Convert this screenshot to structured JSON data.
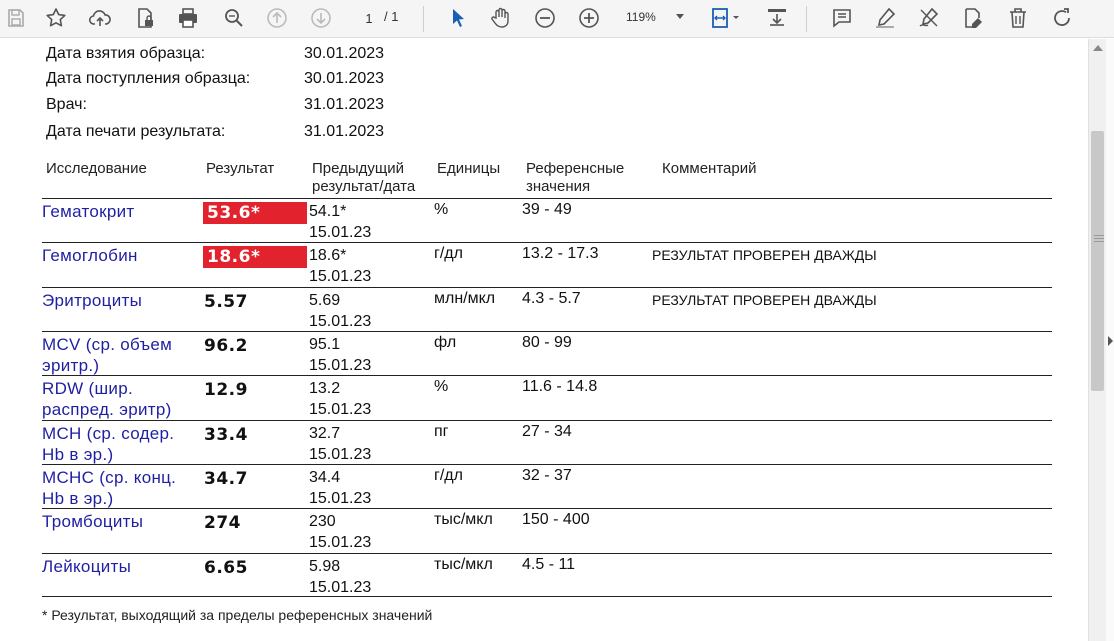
{
  "toolbar": {
    "page_current": "1",
    "page_total": "/ 1",
    "zoom": "119%",
    "icons": [
      "save-icon",
      "bookmark-star-icon",
      "upload-icon",
      "file-lock-icon",
      "print-icon",
      "zoom-search-icon",
      "arrow-up-icon",
      "arrow-down-icon",
      "select-cursor-icon",
      "hand-tool-icon",
      "zoom-out-icon",
      "zoom-in-icon",
      "fit-page-icon",
      "download-tray-icon",
      "comment-icon",
      "highlight-pen-icon",
      "sign-pen-icon",
      "edit-document-icon",
      "trash-icon",
      "rotate-icon"
    ]
  },
  "info": [
    {
      "label": "Дата взятия образца:",
      "value": "30.01.2023"
    },
    {
      "label": "Дата поступления образца:",
      "value": "30.01.2023"
    },
    {
      "label": "Врач:",
      "value": "31.01.2023"
    },
    {
      "label": "Дата печати результата:",
      "value": "31.01.2023"
    }
  ],
  "table": {
    "headers": {
      "test": "Исследование",
      "result": "Результат",
      "prev1": "Предыдущий",
      "prev2": "результат/дата",
      "units": "Единицы",
      "ref1": "Референсные",
      "ref2": "значения",
      "comment": "Комментарий"
    },
    "rows": [
      {
        "name1": "Гематокрит",
        "name2": "",
        "result": "53.6*",
        "flag": true,
        "prev": "54.1*",
        "prev_date": "15.01.23",
        "unit": "%",
        "ref": "39 - 49",
        "comment": ""
      },
      {
        "name1": "Гемоглобин",
        "name2": "",
        "result": "18.6*",
        "flag": true,
        "prev": "18.6*",
        "prev_date": "15.01.23",
        "unit": "г/дл",
        "ref": "13.2 - 17.3",
        "comment": "РЕЗУЛЬТАТ ПРОВЕРЕН ДВАЖДЫ"
      },
      {
        "name1": "Эритроциты",
        "name2": "",
        "result": "5.57",
        "flag": false,
        "prev": "5.69",
        "prev_date": "15.01.23",
        "unit": "млн/мкл",
        "ref": "4.3 - 5.7",
        "comment": "РЕЗУЛЬТАТ ПРОВЕРЕН ДВАЖДЫ"
      },
      {
        "name1": "MCV (ср. объем",
        "name2": "эритр.)",
        "result": "96.2",
        "flag": false,
        "prev": "95.1",
        "prev_date": "15.01.23",
        "unit": "фл",
        "ref": "80 - 99",
        "comment": ""
      },
      {
        "name1": "RDW (шир.",
        "name2": "распред. эритр)",
        "result": "12.9",
        "flag": false,
        "prev": "13.2",
        "prev_date": "15.01.23",
        "unit": "%",
        "ref": "11.6 - 14.8",
        "comment": ""
      },
      {
        "name1": "MCH (ср. содер.",
        "name2": "Hb в эр.)",
        "result": "33.4",
        "flag": false,
        "prev": "32.7",
        "prev_date": "15.01.23",
        "unit": "пг",
        "ref": "27 - 34",
        "comment": ""
      },
      {
        "name1": "MCHC (ср. конц.",
        "name2": "Hb в эр.)",
        "result": "34.7",
        "flag": false,
        "prev": "34.4",
        "prev_date": "15.01.23",
        "unit": "г/дл",
        "ref": "32 - 37",
        "comment": ""
      },
      {
        "name1": "Тромбоциты",
        "name2": "",
        "result": "274",
        "flag": false,
        "prev": "230",
        "prev_date": "15.01.23",
        "unit": "тыс/мкл",
        "ref": "150 - 400",
        "comment": ""
      },
      {
        "name1": "Лейкоциты",
        "name2": "",
        "result": "6.65",
        "flag": false,
        "prev": "5.98",
        "prev_date": "15.01.23",
        "unit": "тыс/мкл",
        "ref": "4.5 - 11",
        "comment": ""
      }
    ]
  },
  "footnote": "* Результат, выходящий за пределы референсных значений",
  "colors": {
    "flag": "#e2222c",
    "link": "#1f1fa3",
    "accent": "#1a5fb4"
  }
}
